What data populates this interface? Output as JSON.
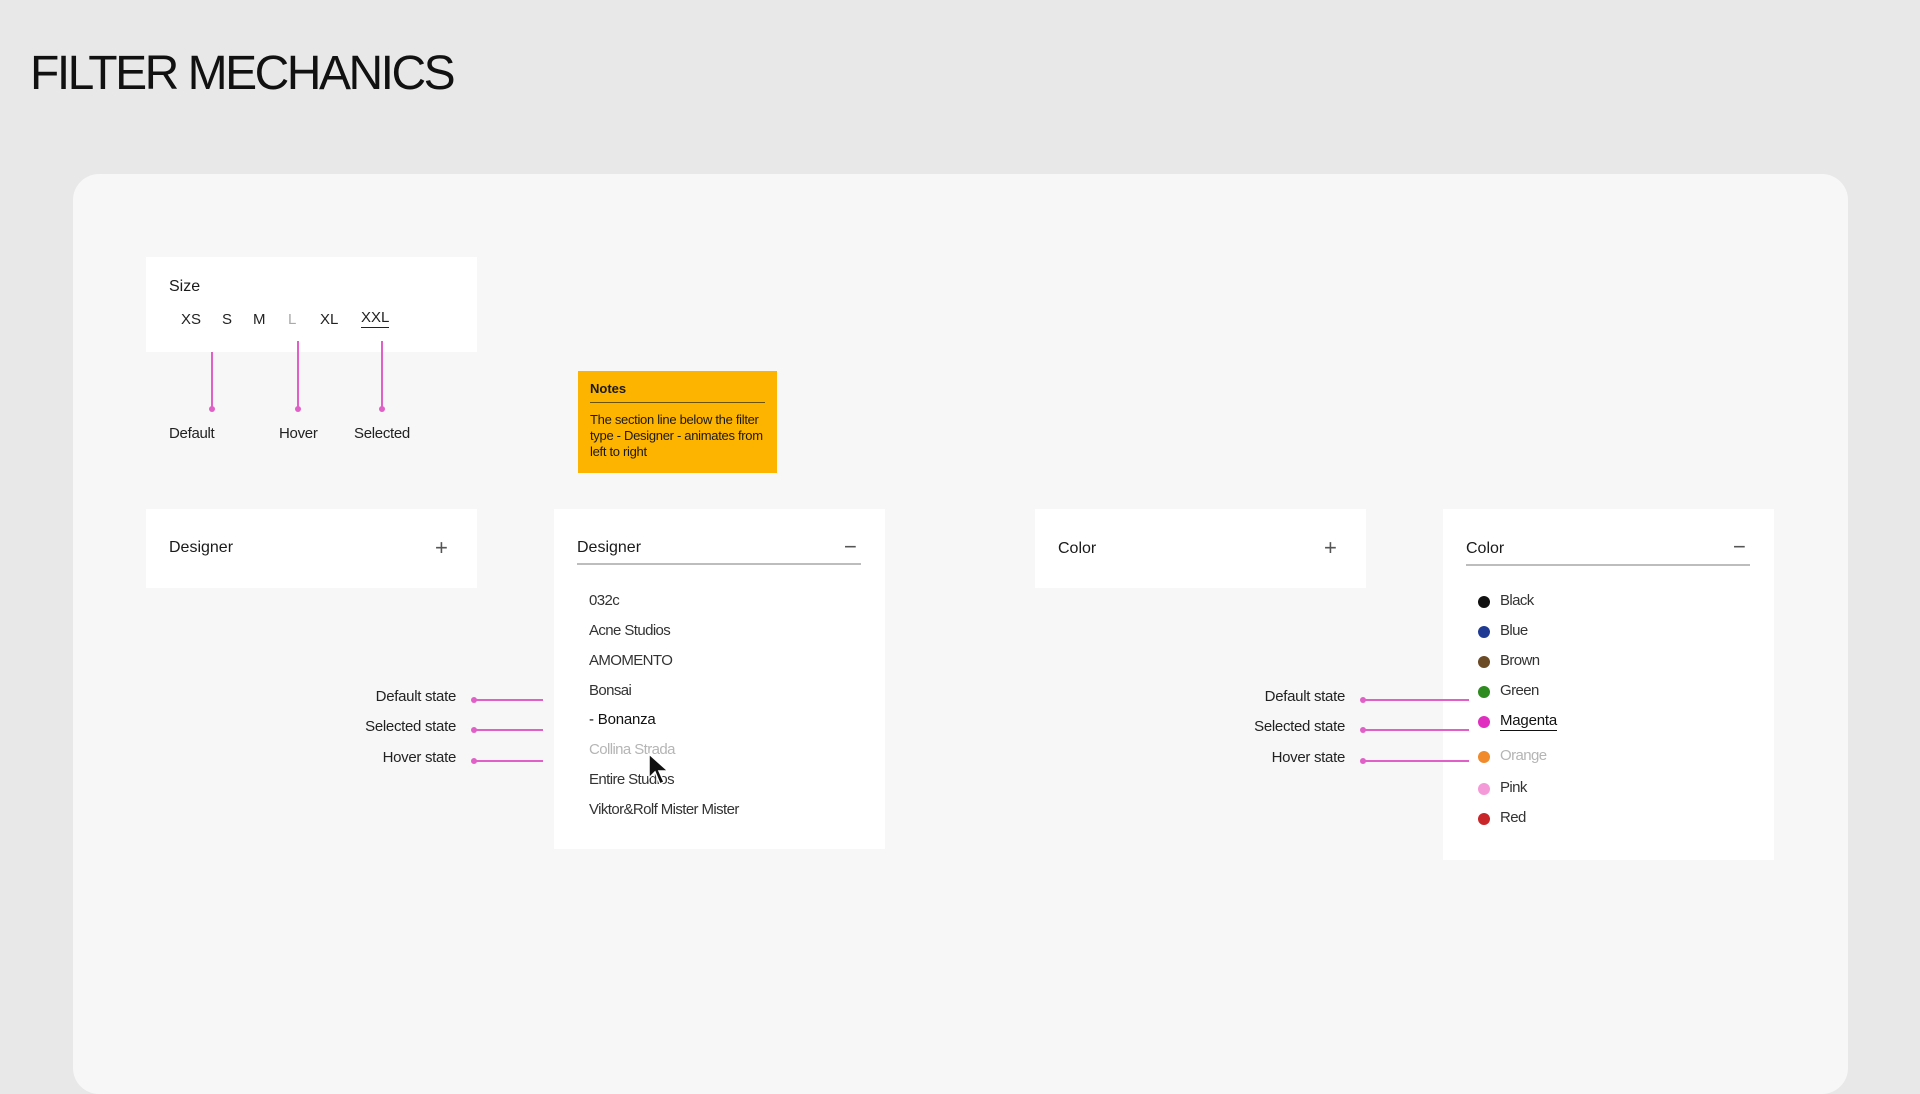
{
  "page": {
    "title": "FILTER MECHANICS"
  },
  "size_filter": {
    "title": "Size",
    "options": [
      "XS",
      "S",
      "M",
      "L",
      "XL",
      "XXL"
    ],
    "hover_option": "L",
    "selected_option": "XXL",
    "annotations": {
      "default": "Default",
      "hover": "Hover",
      "selected": "Selected"
    }
  },
  "notes": {
    "title": "Notes",
    "body": "The section line below the filter type - Designer - animates from left to right"
  },
  "designer_collapsed": {
    "title": "Designer",
    "icon": "plus-icon"
  },
  "designer_expanded": {
    "title": "Designer",
    "icon": "minus-icon",
    "items": [
      "032c",
      "Acne Studios",
      "AMOMENTO",
      "Bonsai",
      "- Bonanza",
      "Collina Strada",
      "Entire Studios",
      "Viktor&Rolf Mister Mister"
    ],
    "selected_item": "- Bonanza",
    "hover_item": "Collina Strada"
  },
  "color_collapsed": {
    "title": "Color",
    "icon": "plus-icon"
  },
  "color_expanded": {
    "title": "Color",
    "icon": "minus-icon",
    "items": [
      {
        "label": "Black",
        "color": "#111111"
      },
      {
        "label": "Blue",
        "color": "#1f3a93"
      },
      {
        "label": "Brown",
        "color": "#6b4a26"
      },
      {
        "label": "Green",
        "color": "#2e8b1f"
      },
      {
        "label": "Magenta",
        "color": "#e02fc0"
      },
      {
        "label": "Orange",
        "color": "#f08a2a"
      },
      {
        "label": "Pink",
        "color": "#f59ad8"
      },
      {
        "label": "Red",
        "color": "#c9262a"
      }
    ],
    "selected_item": "Magenta",
    "hover_item": "Orange"
  },
  "state_annotations": {
    "default": "Default state",
    "selected": "Selected state",
    "hover": "Hover state"
  },
  "colors": {
    "accent_annotation": "#e060c8",
    "notes_bg": "#fdb400"
  }
}
